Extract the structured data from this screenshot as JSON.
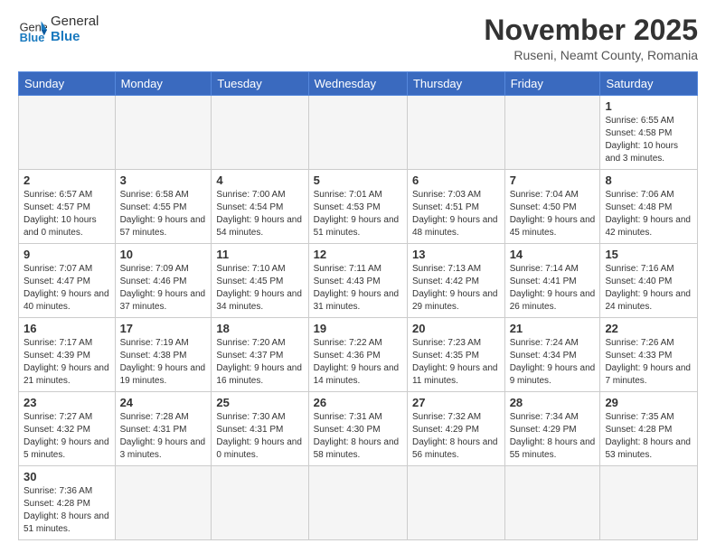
{
  "header": {
    "logo_general": "General",
    "logo_blue": "Blue",
    "month_title": "November 2025",
    "location": "Ruseni, Neamt County, Romania"
  },
  "days_of_week": [
    "Sunday",
    "Monday",
    "Tuesday",
    "Wednesday",
    "Thursday",
    "Friday",
    "Saturday"
  ],
  "weeks": [
    [
      {
        "day": "",
        "info": ""
      },
      {
        "day": "",
        "info": ""
      },
      {
        "day": "",
        "info": ""
      },
      {
        "day": "",
        "info": ""
      },
      {
        "day": "",
        "info": ""
      },
      {
        "day": "",
        "info": ""
      },
      {
        "day": "1",
        "info": "Sunrise: 6:55 AM\nSunset: 4:58 PM\nDaylight: 10 hours and 3 minutes."
      }
    ],
    [
      {
        "day": "2",
        "info": "Sunrise: 6:57 AM\nSunset: 4:57 PM\nDaylight: 10 hours and 0 minutes."
      },
      {
        "day": "3",
        "info": "Sunrise: 6:58 AM\nSunset: 4:55 PM\nDaylight: 9 hours and 57 minutes."
      },
      {
        "day": "4",
        "info": "Sunrise: 7:00 AM\nSunset: 4:54 PM\nDaylight: 9 hours and 54 minutes."
      },
      {
        "day": "5",
        "info": "Sunrise: 7:01 AM\nSunset: 4:53 PM\nDaylight: 9 hours and 51 minutes."
      },
      {
        "day": "6",
        "info": "Sunrise: 7:03 AM\nSunset: 4:51 PM\nDaylight: 9 hours and 48 minutes."
      },
      {
        "day": "7",
        "info": "Sunrise: 7:04 AM\nSunset: 4:50 PM\nDaylight: 9 hours and 45 minutes."
      },
      {
        "day": "8",
        "info": "Sunrise: 7:06 AM\nSunset: 4:48 PM\nDaylight: 9 hours and 42 minutes."
      }
    ],
    [
      {
        "day": "9",
        "info": "Sunrise: 7:07 AM\nSunset: 4:47 PM\nDaylight: 9 hours and 40 minutes."
      },
      {
        "day": "10",
        "info": "Sunrise: 7:09 AM\nSunset: 4:46 PM\nDaylight: 9 hours and 37 minutes."
      },
      {
        "day": "11",
        "info": "Sunrise: 7:10 AM\nSunset: 4:45 PM\nDaylight: 9 hours and 34 minutes."
      },
      {
        "day": "12",
        "info": "Sunrise: 7:11 AM\nSunset: 4:43 PM\nDaylight: 9 hours and 31 minutes."
      },
      {
        "day": "13",
        "info": "Sunrise: 7:13 AM\nSunset: 4:42 PM\nDaylight: 9 hours and 29 minutes."
      },
      {
        "day": "14",
        "info": "Sunrise: 7:14 AM\nSunset: 4:41 PM\nDaylight: 9 hours and 26 minutes."
      },
      {
        "day": "15",
        "info": "Sunrise: 7:16 AM\nSunset: 4:40 PM\nDaylight: 9 hours and 24 minutes."
      }
    ],
    [
      {
        "day": "16",
        "info": "Sunrise: 7:17 AM\nSunset: 4:39 PM\nDaylight: 9 hours and 21 minutes."
      },
      {
        "day": "17",
        "info": "Sunrise: 7:19 AM\nSunset: 4:38 PM\nDaylight: 9 hours and 19 minutes."
      },
      {
        "day": "18",
        "info": "Sunrise: 7:20 AM\nSunset: 4:37 PM\nDaylight: 9 hours and 16 minutes."
      },
      {
        "day": "19",
        "info": "Sunrise: 7:22 AM\nSunset: 4:36 PM\nDaylight: 9 hours and 14 minutes."
      },
      {
        "day": "20",
        "info": "Sunrise: 7:23 AM\nSunset: 4:35 PM\nDaylight: 9 hours and 11 minutes."
      },
      {
        "day": "21",
        "info": "Sunrise: 7:24 AM\nSunset: 4:34 PM\nDaylight: 9 hours and 9 minutes."
      },
      {
        "day": "22",
        "info": "Sunrise: 7:26 AM\nSunset: 4:33 PM\nDaylight: 9 hours and 7 minutes."
      }
    ],
    [
      {
        "day": "23",
        "info": "Sunrise: 7:27 AM\nSunset: 4:32 PM\nDaylight: 9 hours and 5 minutes."
      },
      {
        "day": "24",
        "info": "Sunrise: 7:28 AM\nSunset: 4:31 PM\nDaylight: 9 hours and 3 minutes."
      },
      {
        "day": "25",
        "info": "Sunrise: 7:30 AM\nSunset: 4:31 PM\nDaylight: 9 hours and 0 minutes."
      },
      {
        "day": "26",
        "info": "Sunrise: 7:31 AM\nSunset: 4:30 PM\nDaylight: 8 hours and 58 minutes."
      },
      {
        "day": "27",
        "info": "Sunrise: 7:32 AM\nSunset: 4:29 PM\nDaylight: 8 hours and 56 minutes."
      },
      {
        "day": "28",
        "info": "Sunrise: 7:34 AM\nSunset: 4:29 PM\nDaylight: 8 hours and 55 minutes."
      },
      {
        "day": "29",
        "info": "Sunrise: 7:35 AM\nSunset: 4:28 PM\nDaylight: 8 hours and 53 minutes."
      }
    ],
    [
      {
        "day": "30",
        "info": "Sunrise: 7:36 AM\nSunset: 4:28 PM\nDaylight: 8 hours and 51 minutes."
      },
      {
        "day": "",
        "info": ""
      },
      {
        "day": "",
        "info": ""
      },
      {
        "day": "",
        "info": ""
      },
      {
        "day": "",
        "info": ""
      },
      {
        "day": "",
        "info": ""
      },
      {
        "day": "",
        "info": ""
      }
    ]
  ]
}
